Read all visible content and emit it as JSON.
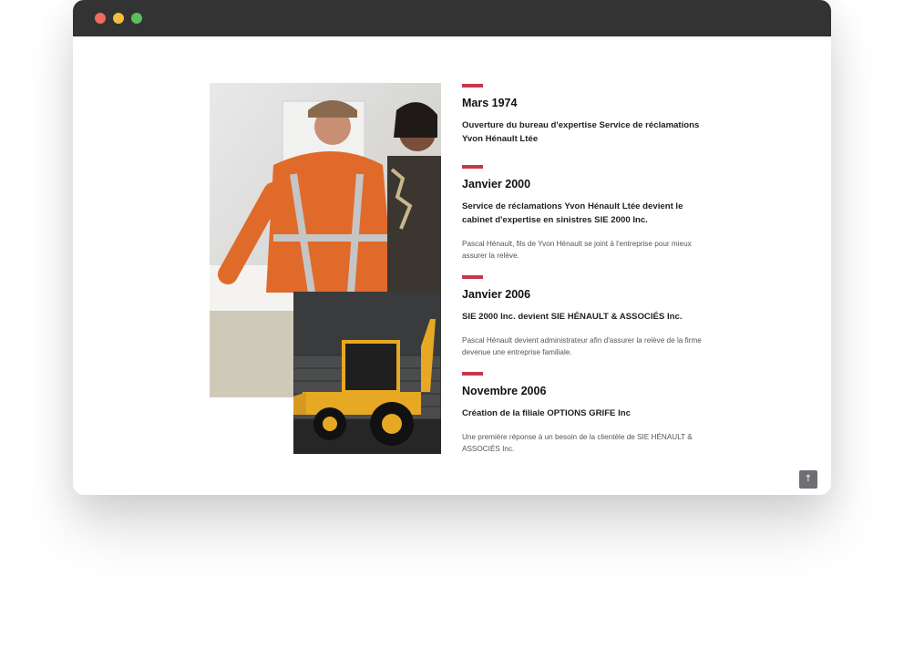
{
  "window": {
    "controls": [
      "close",
      "minimize",
      "maximize"
    ]
  },
  "photos": {
    "team_icon": "photo-team-icon",
    "machine_icon": "photo-backhoe-icon"
  },
  "timeline": {
    "accent_color": "#c8374a",
    "entries": [
      {
        "year": "Mars 1974",
        "headline": "Ouverture du bureau d'expertise Service de réclamations Yvon Hénault Ltée",
        "description": ""
      },
      {
        "year": "Janvier 2000",
        "headline": "Service de réclamations Yvon Hénault Ltée devient le cabinet d'expertise en sinistres SIE 2000 Inc.",
        "description": "Pascal Hénault, fils de Yvon Hénault se joint à l'entreprise pour mieux assurer la relève."
      },
      {
        "year": "Janvier 2006",
        "headline": "SIE 2000 Inc. devient SIE HÉNAULT & ASSOCIÉS Inc.",
        "description": "Pascal Hénault devient administrateur afin d'assurer la relève de la firme devenue une entreprise familiale."
      },
      {
        "year": "Novembre 2006",
        "headline": "Création de la filiale OPTIONS GRIFE Inc",
        "description": "Une première réponse à un besoin de la clientèle de SIE HÉNAULT & ASSOCIÉS Inc."
      }
    ]
  },
  "scroll_top": {
    "icon": "arrow-up-icon",
    "glyph": "↑"
  }
}
